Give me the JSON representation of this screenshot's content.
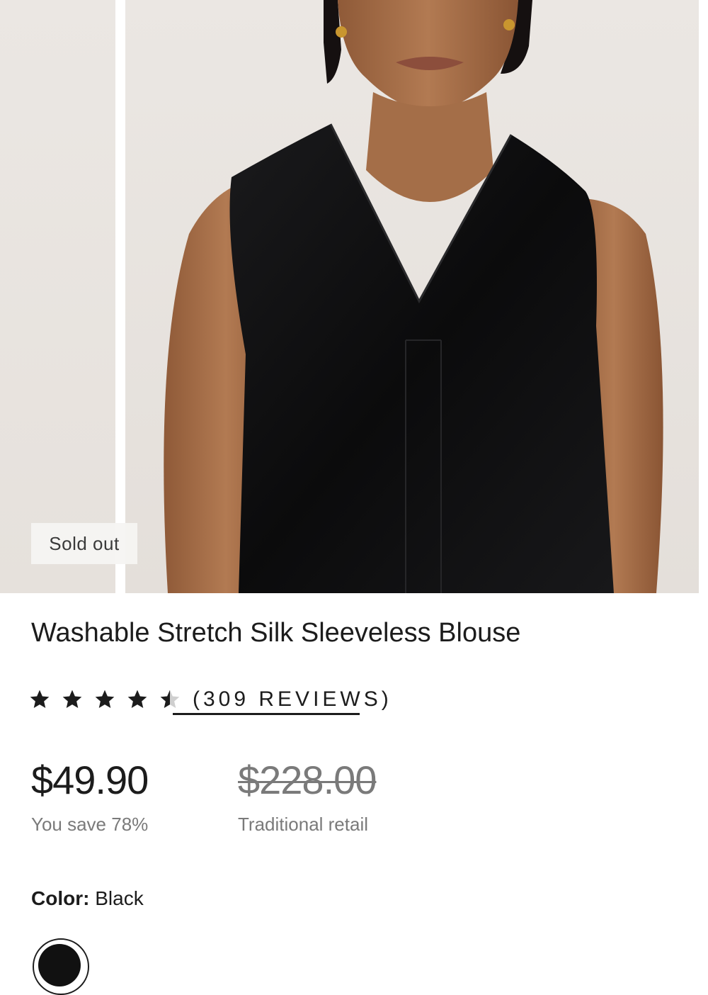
{
  "product": {
    "badge": "Sold out",
    "title": "Washable Stretch Silk Sleeveless Blouse",
    "rating": {
      "value": 4.5,
      "max": 5,
      "reviews_text": "(309 REVIEWS)"
    },
    "price": "$49.90",
    "savings": "You save 78%",
    "retail_price": "$228.00",
    "retail_label": "Traditional retail",
    "color": {
      "label": "Color:",
      "value": "Black"
    }
  },
  "colors": {
    "text": "#1c1c1c",
    "muted": "#7a7a7a",
    "background": "#ffffff",
    "image_backdrop": "#e9e5e1",
    "garment": "#0f0f10",
    "skin": "#a8704a"
  },
  "icons": [
    "star-icon",
    "half-star-icon"
  ]
}
